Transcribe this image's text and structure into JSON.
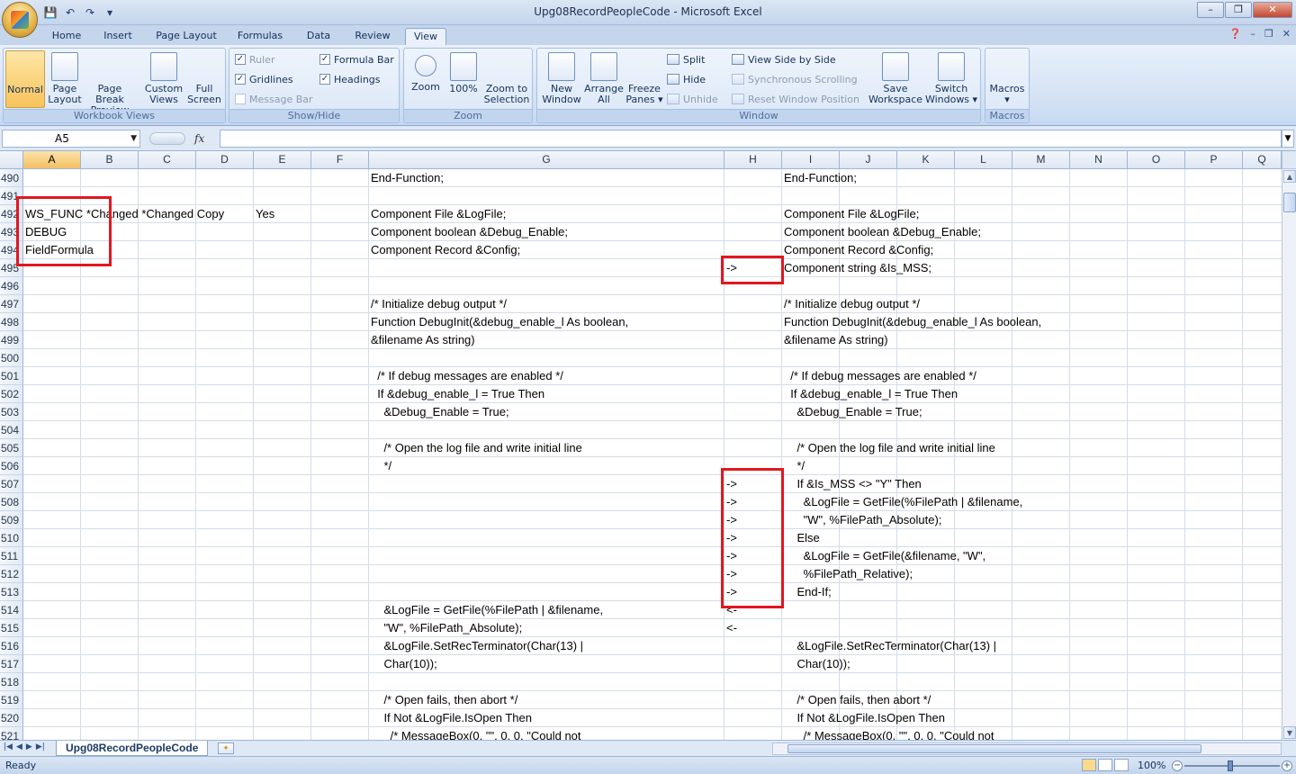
{
  "window": {
    "title": "Upg08RecordPeopleCode - Microsoft Excel",
    "controls": {
      "minimize": "–",
      "maximize": "❐",
      "close": "✕"
    }
  },
  "ribbon_tabs": [
    "Home",
    "Insert",
    "Page Layout",
    "Formulas",
    "Data",
    "Review",
    "View"
  ],
  "active_tab": "View",
  "ribbon": {
    "workbook_views": {
      "label": "Workbook Views",
      "buttons": [
        {
          "line1": "Normal",
          "line2": ""
        },
        {
          "line1": "Page",
          "line2": "Layout"
        },
        {
          "line1": "Page Break",
          "line2": "Preview"
        },
        {
          "line1": "Custom",
          "line2": "Views"
        },
        {
          "line1": "Full",
          "line2": "Screen"
        }
      ]
    },
    "show_hide": {
      "label": "Show/Hide",
      "ruler": "Ruler",
      "formula_bar": "Formula Bar",
      "gridlines": "Gridlines",
      "headings": "Headings",
      "message_bar": "Message Bar"
    },
    "zoom": {
      "label": "Zoom",
      "buttons": [
        {
          "line1": "Zoom",
          "line2": ""
        },
        {
          "line1": "100%",
          "line2": ""
        },
        {
          "line1": "Zoom to",
          "line2": "Selection"
        }
      ]
    },
    "window_group": {
      "label": "Window",
      "new_window": {
        "line1": "New",
        "line2": "Window"
      },
      "arrange_all": {
        "line1": "Arrange",
        "line2": "All"
      },
      "freeze_panes": {
        "line1": "Freeze",
        "line2": "Panes ▾"
      },
      "split": "Split",
      "hide": "Hide",
      "unhide": "Unhide",
      "view_side_by_side": "View Side by Side",
      "synchronous_scrolling": "Synchronous Scrolling",
      "reset_window_position": "Reset Window Position",
      "save_workspace": {
        "line1": "Save",
        "line2": "Workspace"
      },
      "switch_windows": {
        "line1": "Switch",
        "line2": "Windows ▾"
      }
    },
    "macros": {
      "label": "Macros",
      "button": {
        "line1": "Macros",
        "line2": "▾"
      }
    }
  },
  "formula_bar": {
    "name_box": "A5",
    "fx": "fx",
    "formula": ""
  },
  "columns": [
    "A",
    "B",
    "C",
    "D",
    "E",
    "F",
    "G",
    "H",
    "I",
    "J",
    "K",
    "L",
    "M",
    "N",
    "O",
    "P",
    "Q"
  ],
  "rows": [
    {
      "num": "490",
      "A": "",
      "E": "",
      "G": "End-Function;",
      "H": "",
      "I": "End-Function;"
    },
    {
      "num": "491",
      "A": "",
      "E": "",
      "G": "",
      "H": "",
      "I": ""
    },
    {
      "num": "492",
      "A": "WS_FUNC *Changed *Changed Copy",
      "E": "Yes",
      "G": "Component File &LogFile;",
      "H": "",
      "I": "Component File &LogFile;"
    },
    {
      "num": "493",
      "A": "DEBUG",
      "E": "",
      "G": "Component boolean &Debug_Enable;",
      "H": "",
      "I": "Component boolean &Debug_Enable;"
    },
    {
      "num": "494",
      "A": "FieldFormula",
      "E": "",
      "G": "Component Record &Config;",
      "H": "",
      "I": "Component Record &Config;"
    },
    {
      "num": "495",
      "A": "",
      "E": "",
      "G": "",
      "H": "->",
      "I": "Component string &Is_MSS;"
    },
    {
      "num": "496",
      "A": "",
      "E": "",
      "G": "",
      "H": "",
      "I": ""
    },
    {
      "num": "497",
      "A": "",
      "E": "",
      "G": "/* Initialize debug output */",
      "H": "",
      "I": "/* Initialize debug output */"
    },
    {
      "num": "498",
      "A": "",
      "E": "",
      "G": "Function DebugInit(&debug_enable_l As boolean,",
      "H": "",
      "I": "Function DebugInit(&debug_enable_l As boolean,"
    },
    {
      "num": "499",
      "A": "",
      "E": "",
      "G": "&filename As string)",
      "H": "",
      "I": "&filename As string)"
    },
    {
      "num": "500",
      "A": "",
      "E": "",
      "G": "",
      "H": "",
      "I": ""
    },
    {
      "num": "501",
      "A": "",
      "E": "",
      "G": "  /* If debug messages are enabled */",
      "H": "",
      "I": "  /* If debug messages are enabled */"
    },
    {
      "num": "502",
      "A": "",
      "E": "",
      "G": "  If &debug_enable_l = True Then",
      "H": "",
      "I": "  If &debug_enable_l = True Then"
    },
    {
      "num": "503",
      "A": "",
      "E": "",
      "G": "    &Debug_Enable = True;",
      "H": "",
      "I": "    &Debug_Enable = True;"
    },
    {
      "num": "504",
      "A": "",
      "E": "",
      "G": "",
      "H": "",
      "I": ""
    },
    {
      "num": "505",
      "A": "",
      "E": "",
      "G": "    /* Open the log file and write initial line",
      "H": "",
      "I": "    /* Open the log file and write initial line"
    },
    {
      "num": "506",
      "A": "",
      "E": "",
      "G": "    */",
      "H": "",
      "I": "    */"
    },
    {
      "num": "507",
      "A": "",
      "E": "",
      "G": "",
      "H": "->",
      "I": "    If &Is_MSS <> \"Y\" Then"
    },
    {
      "num": "508",
      "A": "",
      "E": "",
      "G": "",
      "H": "->",
      "I": "      &LogFile = GetFile(%FilePath | &filename,"
    },
    {
      "num": "509",
      "A": "",
      "E": "",
      "G": "",
      "H": "->",
      "I": "      \"W\", %FilePath_Absolute);"
    },
    {
      "num": "510",
      "A": "",
      "E": "",
      "G": "",
      "H": "->",
      "I": "    Else"
    },
    {
      "num": "511",
      "A": "",
      "E": "",
      "G": "",
      "H": "->",
      "I": "      &LogFile = GetFile(&filename, \"W\","
    },
    {
      "num": "512",
      "A": "",
      "E": "",
      "G": "",
      "H": "->",
      "I": "      %FilePath_Relative);"
    },
    {
      "num": "513",
      "A": "",
      "E": "",
      "G": "",
      "H": "->",
      "I": "    End-If;"
    },
    {
      "num": "514",
      "A": "",
      "E": "",
      "G": "    &LogFile = GetFile(%FilePath | &filename,",
      "H": "<-",
      "I": ""
    },
    {
      "num": "515",
      "A": "",
      "E": "",
      "G": "    \"W\", %FilePath_Absolute);",
      "H": "<-",
      "I": ""
    },
    {
      "num": "516",
      "A": "",
      "E": "",
      "G": "    &LogFile.SetRecTerminator(Char(13) |",
      "H": "",
      "I": "    &LogFile.SetRecTerminator(Char(13) |"
    },
    {
      "num": "517",
      "A": "",
      "E": "",
      "G": "    Char(10));",
      "H": "",
      "I": "    Char(10));"
    },
    {
      "num": "518",
      "A": "",
      "E": "",
      "G": "",
      "H": "",
      "I": ""
    },
    {
      "num": "519",
      "A": "",
      "E": "",
      "G": "    /* Open fails, then abort */",
      "H": "",
      "I": "    /* Open fails, then abort */"
    },
    {
      "num": "520",
      "A": "",
      "E": "",
      "G": "    If Not &LogFile.IsOpen Then",
      "H": "",
      "I": "    If Not &LogFile.IsOpen Then"
    },
    {
      "num": "521",
      "A": "",
      "E": "",
      "G": "      /* MessageBox(0, \"\", 0, 0, \"Could not",
      "H": "",
      "I": "      /* MessageBox(0, \"\", 0, 0, \"Could not"
    }
  ],
  "sheet_tab": "Upg08RecordPeopleCode",
  "status": {
    "ready": "Ready",
    "zoom": "100%"
  },
  "colors": {
    "highlight_box": "#e0181f",
    "selected_header": "#f2c064"
  }
}
